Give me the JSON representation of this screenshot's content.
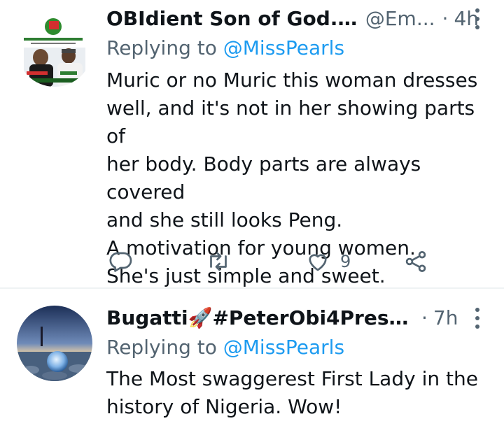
{
  "tweets": [
    {
      "display_name": "OBIdient Son of God....",
      "handle": "@Em...",
      "separator": "·",
      "time": "4h",
      "replying_prefix": "Replying to",
      "replying_to": "@MissPearls",
      "text": "Muric or no Muric this woman dresses\nwell, and it's not in her showing parts of\nher body. Body parts are always covered\nand she still looks Peng.\nA motivation for young women.\nShe's just simple and sweet.",
      "like_count": "9",
      "avatar_icon": "campaign-poster-avatar"
    },
    {
      "display_name": "Bugatti🚀#PeterObi4Preside...",
      "separator": "·",
      "time": "7h",
      "replying_prefix": "Replying to",
      "replying_to": "@MissPearls",
      "text": "The Most swaggerest First Lady in the\nhistory of Nigeria. Wow!",
      "avatar_icon": "crystal-ball-avatar"
    }
  ],
  "colors": {
    "accent": "#1d9bf0",
    "secondary_text": "#536471",
    "primary_text": "#0f1419",
    "separator": "#eff3f4"
  }
}
